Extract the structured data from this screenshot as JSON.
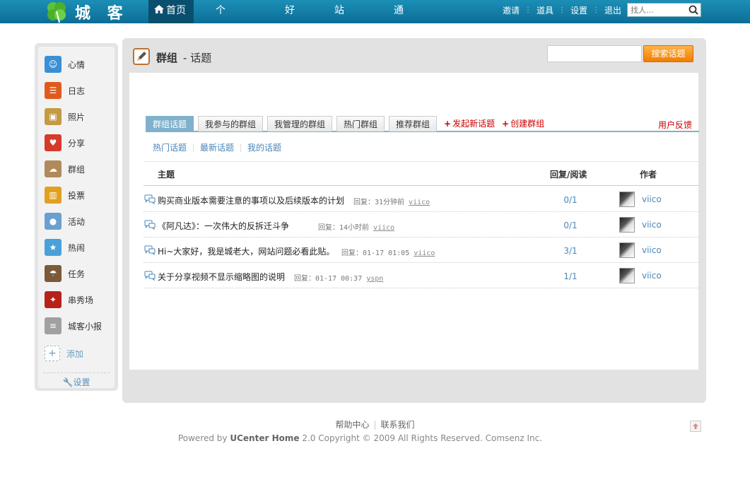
{
  "header": {
    "logo_text": "城 客",
    "nav": [
      {
        "label": "首页"
      },
      {
        "label": "个人主页"
      },
      {
        "label": "好友"
      },
      {
        "label": "站内信"
      },
      {
        "label": "通知"
      }
    ],
    "links": [
      "邀请",
      "道具",
      "设置",
      "退出"
    ],
    "search_placeholder": "找人..."
  },
  "sidebar": {
    "apps": [
      {
        "label": "心情",
        "icon": "smiley-icon",
        "color": "#3b8fd4"
      },
      {
        "label": "日志",
        "icon": "notepad-icon",
        "color": "#e05a1c"
      },
      {
        "label": "照片",
        "icon": "photo-icon",
        "color": "#c49a45"
      },
      {
        "label": "分享",
        "icon": "heart-icon",
        "color": "#d63a2a"
      },
      {
        "label": "群组",
        "icon": "group-icon",
        "color": "#b08a5a"
      },
      {
        "label": "投票",
        "icon": "poll-icon",
        "color": "#e0a020"
      },
      {
        "label": "活动",
        "icon": "event-icon",
        "color": "#6a9fd0"
      },
      {
        "label": "热闹",
        "icon": "hot-icon",
        "color": "#4aa0d8"
      },
      {
        "label": "任务",
        "icon": "task-icon",
        "color": "#7a5a3a"
      },
      {
        "label": "串秀场",
        "icon": "show-icon",
        "color": "#b8201a"
      },
      {
        "label": "城客小报",
        "icon": "newspaper-icon",
        "color": "#a0a0a0"
      }
    ],
    "add_label": "添加",
    "settings_label": "设置"
  },
  "main": {
    "title": "群组",
    "subtitle": "- 话题",
    "search_button": "搜索话题",
    "tabs": [
      "群组话题",
      "我参与的群组",
      "我管理的群组",
      "热门群组",
      "推荐群组"
    ],
    "actions": [
      "发起新话题",
      "创建群组"
    ],
    "feedback": "用户反馈",
    "subtabs": [
      "热门话题",
      "最新话题",
      "我的话题"
    ],
    "table": {
      "headers": {
        "topic": "主题",
        "reply": "回复/阅读",
        "author": "作者"
      },
      "rows": [
        {
          "title": "购买商业版本需要注意的事项以及后续版本的计划",
          "meta": "回复：31分钟前",
          "user": "viico",
          "count": "0/1",
          "author": "viico"
        },
        {
          "title": "《阿凡达》：一次伟大的反拆迁斗争",
          "meta": "回复：14小时前",
          "user": "viico",
          "count": "0/1",
          "author": "viico"
        },
        {
          "title": "Hi~大家好，我是城老大，网站问题必看此贴。",
          "meta": "回复：01-17 01:05",
          "user": "viico",
          "count": "3/1",
          "author": "viico"
        },
        {
          "title": "关于分享视频不显示缩略图的说明",
          "meta": "回复：01-17 00:37",
          "user": "yspn",
          "count": "1/1",
          "author": "viico"
        }
      ]
    }
  },
  "footer": {
    "links": [
      "帮助中心",
      "联系我们"
    ],
    "powered_prefix": "Powered by",
    "product": "UCenter Home",
    "copyright_rest": "2.0 Copyright © 2009 All Rights Reserved. Comsenz Inc."
  }
}
